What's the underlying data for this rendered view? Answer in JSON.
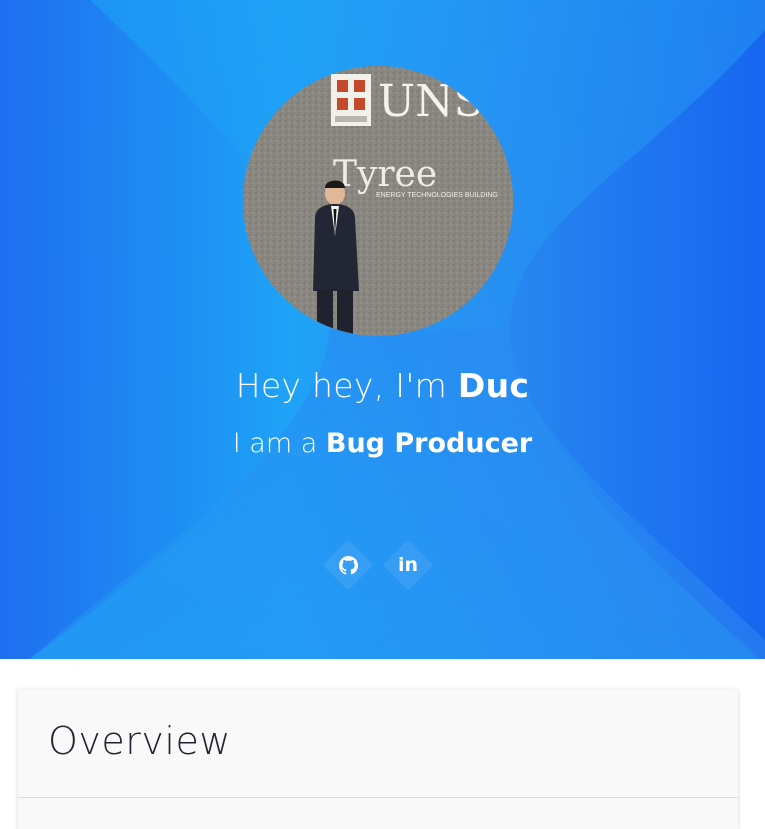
{
  "hero": {
    "greeting_prefix": "Hey hey, I'm ",
    "name": "Duc",
    "role_prefix": "I am a ",
    "role": "Bug Producer",
    "colors": {
      "gradient_left": "#1e6ff0",
      "gradient_mid": "#1ea3f6",
      "gradient_right": "#1666ef"
    }
  },
  "avatar": {
    "sign_text": "UNSW",
    "building_name": "Tyree",
    "building_subtitle": "ENERGY TECHNOLOGIES BUILDING"
  },
  "social": {
    "github_icon": "github-icon",
    "linkedin_label": "in"
  },
  "overview": {
    "title": "Overview"
  }
}
